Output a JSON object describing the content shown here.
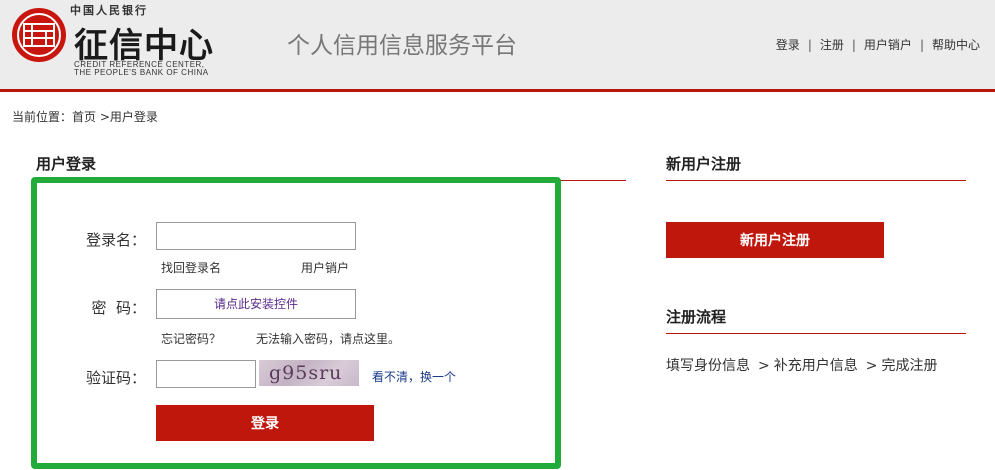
{
  "header": {
    "logo_top": "中国人民银行",
    "logo_main": "征信中心",
    "logo_en_line1": "CREDIT REFERENCE CENTER,",
    "logo_en_line2": "THE PEOPLE'S BANK OF CHINA",
    "logo_icon": "credit-seal-icon",
    "platform_title": "个人信用信息服务平台",
    "nav": [
      {
        "label": "登录"
      },
      {
        "label": "注册"
      },
      {
        "label": "用户销户"
      },
      {
        "label": "帮助中心"
      }
    ],
    "nav_separator": "|"
  },
  "breadcrumb": {
    "prefix": "当前位置：",
    "home": "首页",
    "arrow": ">",
    "current": "用户登录"
  },
  "login": {
    "title": "用户登录",
    "username_label": "登录名：",
    "username_value": "",
    "find_username": "找回登录名",
    "cancel_account": "用户销户",
    "password_label": "密  码：",
    "password_button": "请点此安装控件",
    "forgot_password": "忘记密码？",
    "cannot_input_password": "无法输入密码，请点这里。",
    "captcha_label": "验证码：",
    "captcha_value": "",
    "captcha_text": "g95sru",
    "captcha_refresh": "看不清，换一个",
    "submit": "登录"
  },
  "register": {
    "title": "新用户注册",
    "button": "新用户注册",
    "process_title": "注册流程",
    "steps": [
      "填写身份信息",
      "补充用户信息",
      "完成注册"
    ],
    "step_arrow": ">"
  },
  "colors": {
    "accent_red": "#c0170c",
    "rule_red": "#b8160d",
    "highlight_green": "#22aa3a",
    "header_bg": "#ececec"
  }
}
